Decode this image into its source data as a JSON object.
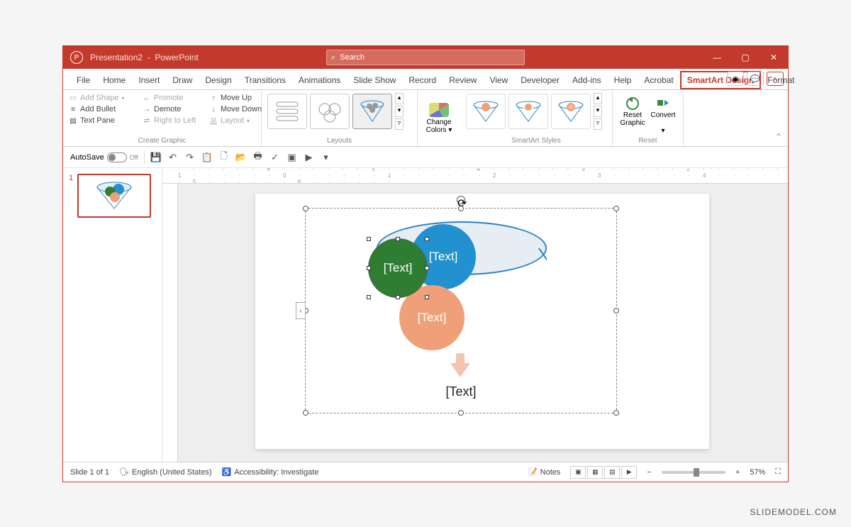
{
  "title": {
    "doc": "Presentation2",
    "app": "PowerPoint",
    "search_placeholder": "Search"
  },
  "window_controls": {
    "min": "—",
    "max": "▢",
    "close": "✕"
  },
  "tabs": [
    "File",
    "Home",
    "Insert",
    "Draw",
    "Design",
    "Transitions",
    "Animations",
    "Slide Show",
    "Record",
    "Review",
    "View",
    "Developer",
    "Add-ins",
    "Help",
    "Acrobat",
    "SmartArt Design",
    "Format"
  ],
  "active_tab": "SmartArt Design",
  "ribbon_right": {
    "record": "◉",
    "comments": "💬",
    "overflow": "›"
  },
  "create_graphic": {
    "add_shape": "Add Shape",
    "promote": "Promote",
    "move_up": "Move Up",
    "add_bullet": "Add Bullet",
    "demote": "Demote",
    "move_down": "Move Down",
    "text_pane": "Text Pane",
    "rtl": "Right to Left",
    "layout": "Layout",
    "group_label": "Create Graphic"
  },
  "layouts": {
    "group_label": "Layouts"
  },
  "change_colors": {
    "label_line1": "Change",
    "label_line2": "Colors"
  },
  "styles": {
    "group_label": "SmartArt Styles"
  },
  "reset": {
    "reset_graphic_l1": "Reset",
    "reset_graphic_l2": "Graphic",
    "convert": "Convert",
    "group_label": "Reset"
  },
  "qat": {
    "autosave": "AutoSave",
    "autosave_state": "Off"
  },
  "ruler_marks": "· · · · · · 6 · · · · · · 5 · · · · · · 4 · · · · · · 3 · · · · · · 2 · · · · · · 1 · · · · · · 0 · · · · · · 1 · · · · · · 2 · · · · · · 3 · · · · · · 4 · · · · · · 5 · · · · · · 6 · · · · · ·",
  "slide_panel": {
    "num": "1"
  },
  "smartart": {
    "text_placeholder": "[Text]"
  },
  "status": {
    "slide": "Slide 1 of 1",
    "lang": "English (United States)",
    "accessibility": "Accessibility: Investigate",
    "notes": "Notes",
    "zoom": "57%",
    "minus": "−",
    "plus": "+",
    "fit": "⛶"
  },
  "watermark": "SLIDEMODEL.COM"
}
